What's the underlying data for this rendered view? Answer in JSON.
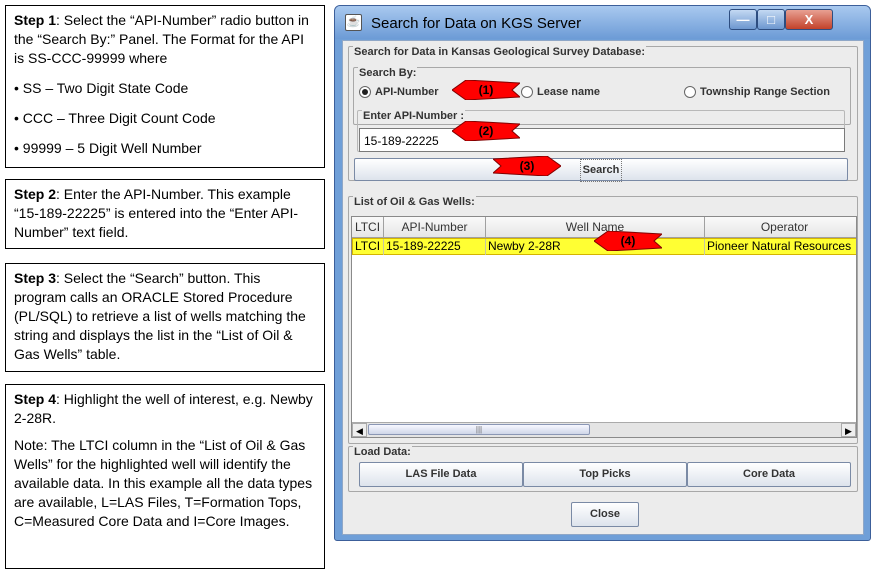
{
  "steps": {
    "step1": {
      "label": "Step 1",
      "text": ": Select the “API-Number” radio button in the “Search By:” Panel.  The Format for the API is SS-CCC-99999 where",
      "bullets": [
        "• SS – Two Digit State Code",
        "• CCC – Three Digit Count Code",
        "• 99999 – 5 Digit Well Number"
      ]
    },
    "step2": {
      "label": "Step 2",
      "text": ": Enter the API-Number. This example “15-189-22225” is entered into the “Enter API-Number” text field."
    },
    "step3": {
      "label": "Step 3",
      "text": ": Select the “Search” button.  This program calls an ORACLE Stored Procedure (PL/SQL) to retrieve a list of wells matching the string and displays the list in the “List of Oil & Gas Wells” table."
    },
    "step4": {
      "label": "Step 4",
      "text": ": Highlight the well of interest, e.g. Newby 2-28R.",
      "note": "Note: The LTCI column in the “List of Oil & Gas Wells” for the highlighted well will identify the available data. In this example all the data types are available, L=LAS Files, T=Formation Tops, C=Measured Core Data and I=Core Images."
    }
  },
  "window": {
    "title": "Search for Data on KGS Server",
    "min_glyph": "—",
    "max_glyph": "□",
    "close_glyph": "X"
  },
  "search_panel": {
    "title": "Search for Data in Kansas Geological Survey Database:",
    "search_by": {
      "title": "Search By:",
      "options": [
        "API-Number",
        "Lease name",
        "Township Range Section"
      ],
      "selected": "API-Number"
    },
    "api_group_title": "Enter API-Number :",
    "api_value": "15-189-22225",
    "search_button": "Search"
  },
  "wells_panel": {
    "title": "List of Oil & Gas Wells:",
    "columns": [
      "LTCI",
      "API-Number",
      "Well Name",
      "Operator"
    ],
    "rows": [
      [
        "LTCI",
        "15-189-22225",
        "Newby 2-28R",
        "Pioneer Natural Resources"
      ]
    ],
    "scroll_left": "◀",
    "scroll_right": "▶",
    "scroll_thumb": "|||"
  },
  "load_panel": {
    "title": "Load Data:",
    "buttons": [
      "LAS File Data",
      "Top Picks",
      "Core Data"
    ]
  },
  "close_button": "Close",
  "callouts": [
    "(1)",
    "(2)",
    "(3)",
    "(4)"
  ],
  "colors": {
    "highlight_row": "#ffff33",
    "callout_red": "#ff0000",
    "title_blue": "#6c9bd6"
  }
}
